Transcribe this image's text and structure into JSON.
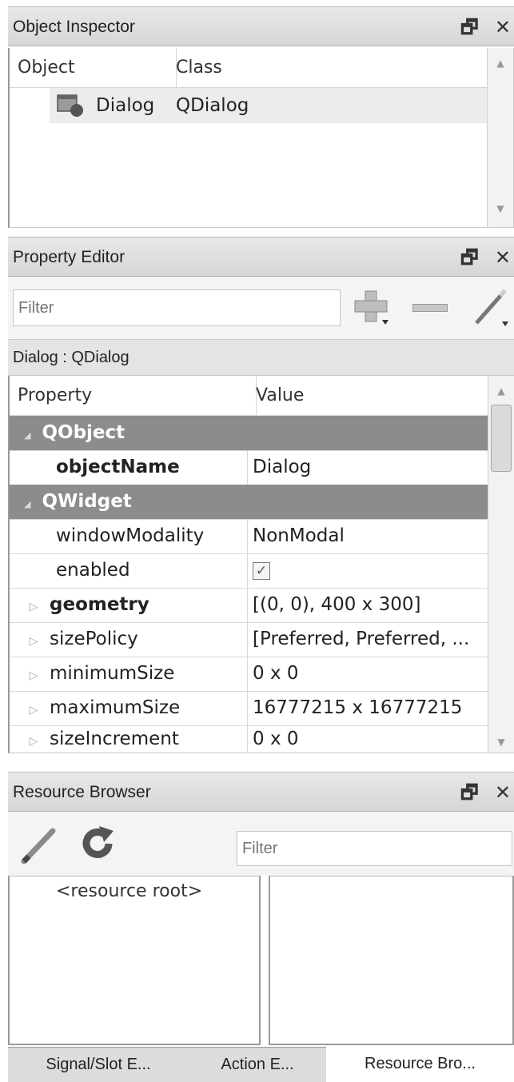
{
  "object_inspector": {
    "title": "Object Inspector",
    "float_glyph": "🗗",
    "close_glyph": "✕",
    "columns": [
      "Object",
      "Class"
    ],
    "rows": [
      {
        "icon": "dialog-window-icon",
        "object": "Dialog",
        "class": "QDialog"
      }
    ]
  },
  "property_editor": {
    "title": "Property Editor",
    "float_glyph": "🗗",
    "close_glyph": "✕",
    "filter_placeholder": "Filter",
    "context": "Dialog : QDialog",
    "columns": [
      "Property",
      "Value"
    ],
    "rows": [
      {
        "type": "group",
        "name": "QObject"
      },
      {
        "type": "prop",
        "name": "objectName",
        "value": "Dialog",
        "bold": true,
        "expandable": false
      },
      {
        "type": "group",
        "name": "QWidget"
      },
      {
        "type": "prop",
        "name": "windowModality",
        "value": "NonModal",
        "bold": false,
        "expandable": false
      },
      {
        "type": "prop",
        "name": "enabled",
        "value": "✓",
        "bold": false,
        "expandable": false
      },
      {
        "type": "prop",
        "name": "geometry",
        "value": "[(0, 0), 400 x 300]",
        "bold": true,
        "expandable": true
      },
      {
        "type": "prop",
        "name": "sizePolicy",
        "value": "[Preferred, Preferred, ...",
        "bold": false,
        "expandable": true
      },
      {
        "type": "prop",
        "name": "minimumSize",
        "value": "0 x 0",
        "bold": false,
        "expandable": true
      },
      {
        "type": "prop",
        "name": "maximumSize",
        "value": "16777215 x 16777215",
        "bold": false,
        "expandable": true
      },
      {
        "type": "prop",
        "name": "sizeIncrement",
        "value": "0 x 0",
        "bold": false,
        "expandable": true
      }
    ],
    "expand_glyph": "▷",
    "collapse_glyph": "◢"
  },
  "resource_browser": {
    "title": "Resource Browser",
    "float_glyph": "🗗",
    "close_glyph": "✕",
    "filter_placeholder": "Filter",
    "tree_root": "<resource root>"
  },
  "bottom_tabs": [
    {
      "label": "Signal/Slot E...",
      "active": false
    },
    {
      "label": "Action E...",
      "active": false
    },
    {
      "label": "Resource Bro...",
      "active": true
    }
  ],
  "colors": {
    "group_row": "#8c8c8c",
    "titlebar": "#dcdcdc",
    "selected_row": "#ececec"
  }
}
